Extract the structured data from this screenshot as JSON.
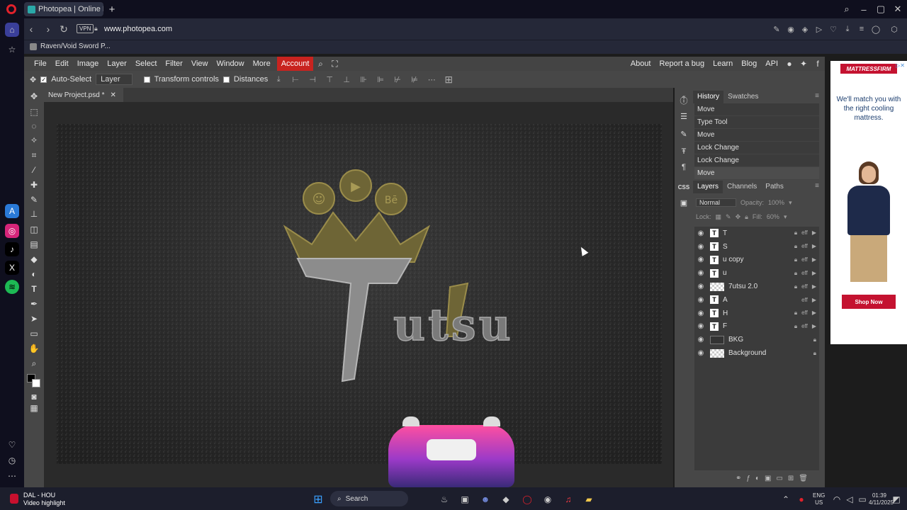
{
  "browser": {
    "tab_title": "Photopea | Online Photo E",
    "vpn_label": "VPN",
    "url": "www.photopea.com",
    "bookmark": "Raven/Void Sword P..."
  },
  "menu": {
    "items": [
      "File",
      "Edit",
      "Image",
      "Layer",
      "Select",
      "Filter",
      "View",
      "Window",
      "More",
      "Account"
    ],
    "right_items": [
      "About",
      "Report a bug",
      "Learn",
      "Blog",
      "API"
    ]
  },
  "options": {
    "auto_select": "Auto-Select",
    "layer_select": "Layer",
    "transform_controls": "Transform controls",
    "distances": "Distances"
  },
  "document": {
    "tab_title": "New Project.psd *"
  },
  "artwork": {
    "badges": [
      "☺",
      "▶",
      "Bē"
    ],
    "letters": "uıtsu",
    "wordmark": "utsu"
  },
  "history": {
    "tabs": [
      "History",
      "Swatches"
    ],
    "items": [
      "Move",
      "Type Tool",
      "Move",
      "Lock Change",
      "Lock Change",
      "Move"
    ]
  },
  "layers": {
    "tabs": [
      "Layers",
      "Channels",
      "Paths"
    ],
    "blend_mode": "Normal",
    "opacity_label": "Opacity:",
    "opacity_value": "100%",
    "lock_label": "Lock:",
    "fill_label": "Fill:",
    "fill_value": "60%",
    "fx_label": "eff",
    "rows": [
      {
        "name": "T",
        "kind": "text"
      },
      {
        "name": "S",
        "kind": "text"
      },
      {
        "name": "u copy",
        "kind": "text"
      },
      {
        "name": "u",
        "kind": "text"
      },
      {
        "name": "7utsu 2.0",
        "kind": "image"
      },
      {
        "name": "A",
        "kind": "text"
      },
      {
        "name": "H",
        "kind": "text"
      },
      {
        "name": "F",
        "kind": "text"
      },
      {
        "name": "BKG",
        "kind": "dark"
      },
      {
        "name": "Background",
        "kind": "image"
      }
    ]
  },
  "ad": {
    "brand": "MATTRESSFIRM",
    "headline": "We'll match you with the right cooling mattress.",
    "cta": "Shop Now"
  },
  "taskbar": {
    "notification_title": "DAL - HOU",
    "notification_sub": "Video highlight",
    "search": "Search",
    "lang_top": "ENG",
    "lang_bottom": "US",
    "time": "01:39",
    "date": "4/11/2025"
  },
  "colors": {
    "accent": "#c8231f",
    "panel": "#474747",
    "workspace": "#2a2a2a",
    "gold": "#8a7a3a"
  }
}
